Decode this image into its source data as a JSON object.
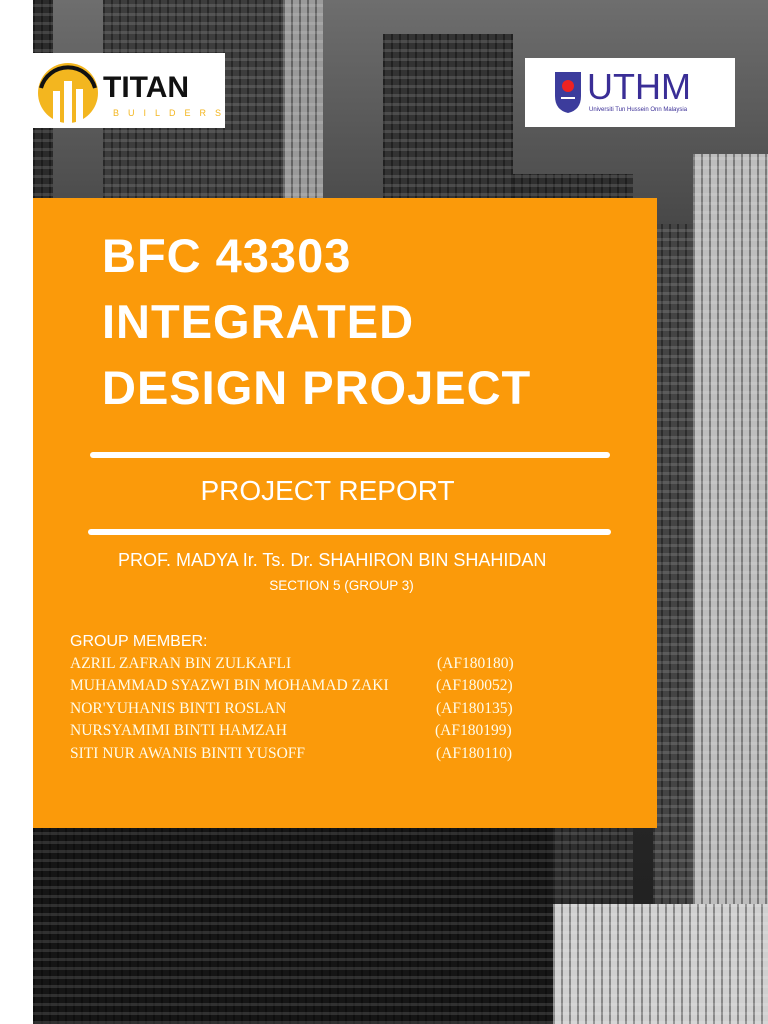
{
  "logos": {
    "left": {
      "name": "TITAN",
      "sub": "BUILDERS"
    },
    "right": {
      "name": "UTHM",
      "sub": "Universiti Tun Hussein Onn Malaysia"
    }
  },
  "title": [
    "BFC 43303",
    "INTEGRATED",
    "DESIGN PROJECT"
  ],
  "subtitle": "PROJECT REPORT",
  "supervisor": "PROF. MADYA Ir. Ts. Dr. SHAHIRON BIN SHAHIDAN",
  "section": "SECTION 5 (GROUP 3)",
  "group_label": "GROUP MEMBER:",
  "members": [
    {
      "name": "AZRIL ZAFRAN BIN ZULKAFLI",
      "id": "(AF180180)"
    },
    {
      "name": "MUHAMMAD SYAZWI BIN MOHAMAD ZAKI",
      "id": "(AF180052)"
    },
    {
      "name": "NOR'YUHANIS BINTI ROSLAN",
      "id": "(AF180135)"
    },
    {
      "name": "NURSYAMIMI BINTI HAMZAH",
      "id": "(AF180199)"
    },
    {
      "name": "SITI NUR AWANIS BINTI YUSOFF",
      "id": "(AF180110)"
    }
  ]
}
